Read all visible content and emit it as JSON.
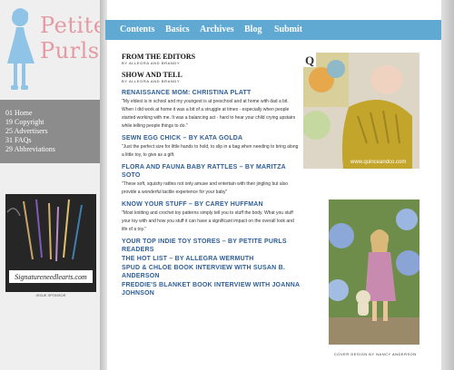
{
  "logo": {
    "line1": "Petite",
    "line2": "Purls"
  },
  "sidebar": {
    "items": [
      {
        "num": "01",
        "label": "Home"
      },
      {
        "num": "19",
        "label": "Copyright"
      },
      {
        "num": "25",
        "label": "Advertisers"
      },
      {
        "num": "31",
        "label": "FAQs"
      },
      {
        "num": "29",
        "label": "Abbreviations"
      }
    ],
    "ad_url": "Signatureneedlearts.com",
    "ad_sponsor": "ISSUE SPONSOR"
  },
  "topnav": {
    "items": [
      "Contents",
      "Basics",
      "Archives",
      "Blog",
      "Submit"
    ]
  },
  "content": {
    "from_editors": "FROM THE EDITORS",
    "from_editors_sub": "BY ALLEGRA AND BRANDY",
    "show_tell": "SHOW AND TELL",
    "show_tell_sub": "BY ALLEGRA AND BRANDY",
    "articles": [
      {
        "title": "RENAISSANCE MOM: CHRISTINA PLATT",
        "body": "\"My eldest is in school and my youngest is at preschool and at home with dad a bit. When I did work at home it was a bit of a struggle at times - especially when people started working with me. It was a balancing act - hard to hear your child crying upstairs while telling people things to do.\""
      },
      {
        "title": "SEWN EGG CHICK – BY KATA GOLDA",
        "body": "\"Just the perfect size for little hands to hold, to slip in a bag when needing to bring along a little toy, to give as a gift."
      },
      {
        "title": "FLORA AND FAUNA BABY RATTLES – BY MARITZA SOTO",
        "body": "\"These soft, squishy rattles not only amuse and entertain with their jingling but also provide a wonderful tactile experience for your baby\""
      },
      {
        "title": "KNOW YOUR STUFF – BY CAREY HUFFMAN",
        "body": "\"Most knitting and crochet toy patterns simply tell you to stuff the body. What you stuff your toy with and how you stuff it can have a significant impact on the overall look and life of a toy.\""
      },
      {
        "title": "YOUR TOP INDIE TOY STORES – BY PETITE PURLS READERS",
        "body": ""
      },
      {
        "title": "THE HOT LIST – BY ALLEGRA WERMUTH",
        "body": ""
      },
      {
        "title": "SPUD & CHLOE BOOK INTERVIEW WITH SUSAN B. ANDERSON",
        "body": ""
      },
      {
        "title": "FREDDIE'S BLANKET BOOK INTERVIEW WITH JOANNA JOHNSON",
        "body": ""
      }
    ]
  },
  "images": {
    "top_credit": "www.quinceandco.com",
    "top_badge": "Q",
    "bottom_credit": "COVER DESIGN BY NANCY ANDERSON"
  },
  "colors": {
    "nav_bg": "#5fa9d3",
    "link": "#2e5e96",
    "logo": "#e59aa3",
    "sidebar_gray": "#8c8c8c"
  }
}
